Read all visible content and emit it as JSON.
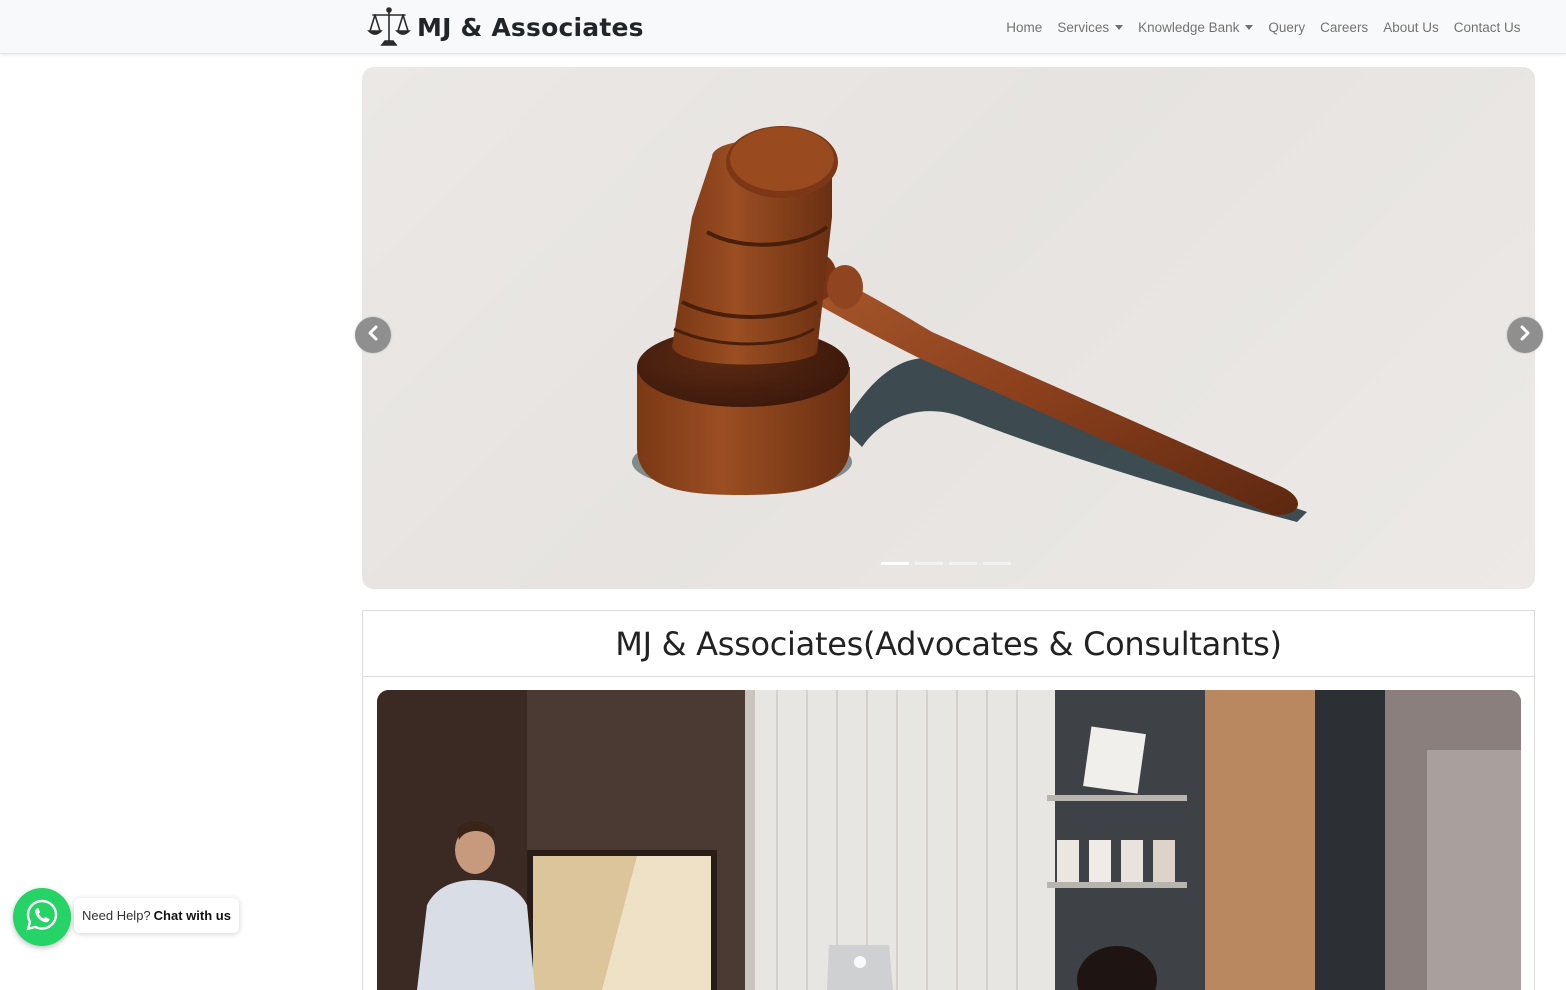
{
  "brand": {
    "name": "MJ & Associates",
    "logo_icon": "scales-of-justice-icon"
  },
  "nav": {
    "items": [
      {
        "label": "Home",
        "dropdown": false
      },
      {
        "label": "Services",
        "dropdown": true
      },
      {
        "label": "Knowledge Bank",
        "dropdown": true
      },
      {
        "label": "Query",
        "dropdown": false
      },
      {
        "label": "Careers",
        "dropdown": false
      },
      {
        "label": "About Us",
        "dropdown": false
      },
      {
        "label": "Contact Us",
        "dropdown": false
      }
    ]
  },
  "carousel": {
    "slide_image": "judge-gavel-on-sound-block",
    "slide_count": 4,
    "active_slide": 1,
    "prev_icon": "chevron-left-icon",
    "next_icon": "chevron-right-icon"
  },
  "intro_card": {
    "title": "MJ & Associates(Advocates & Consultants)",
    "image": "office-meeting-presentation"
  },
  "whatsapp": {
    "icon": "whatsapp-icon",
    "prefix": "Need Help?",
    "cta": "Chat with us",
    "color": "#25d366"
  }
}
